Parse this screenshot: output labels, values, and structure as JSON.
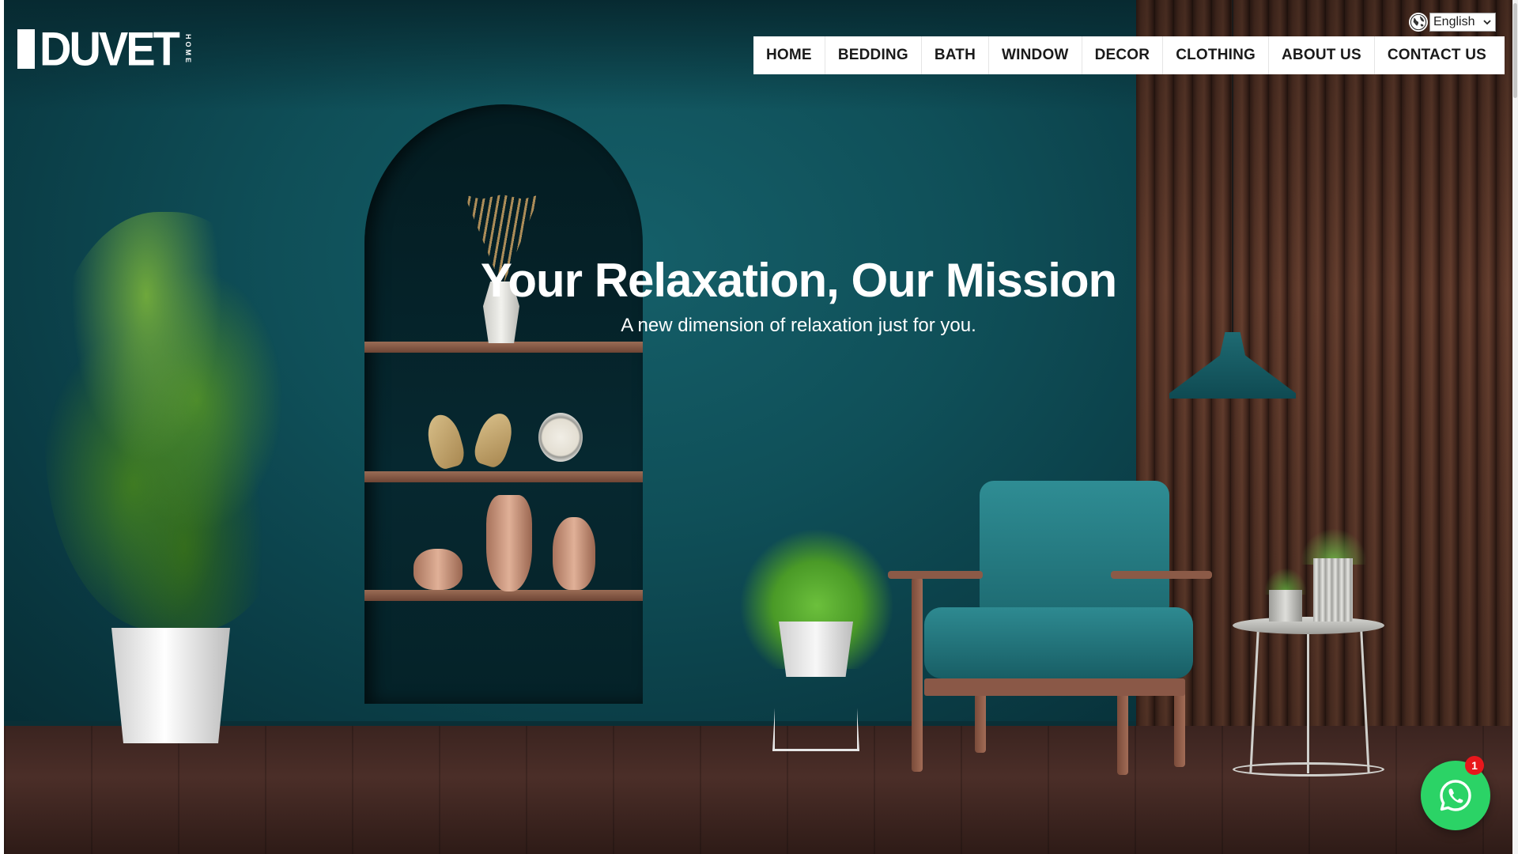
{
  "logo": {
    "main": "DUVET",
    "sub": "HOME"
  },
  "language": {
    "selected": "English"
  },
  "nav": {
    "items": [
      {
        "label": "HOME"
      },
      {
        "label": "BEDDING"
      },
      {
        "label": "BATH"
      },
      {
        "label": "WINDOW"
      },
      {
        "label": "DECOR"
      },
      {
        "label": "CLOTHING"
      },
      {
        "label": "ABOUT US"
      },
      {
        "label": "CONTACT US"
      }
    ]
  },
  "hero": {
    "headline": "Your Relaxation, Our Mission",
    "subheadline": "A new dimension of relaxation just for you."
  },
  "whatsapp": {
    "badge_count": "1",
    "icon": "whatsapp-icon",
    "color": "#2bd366"
  },
  "colors": {
    "wall": "#0e4c55",
    "nav_bg": "#ffffff",
    "badge": "#e8171c"
  }
}
